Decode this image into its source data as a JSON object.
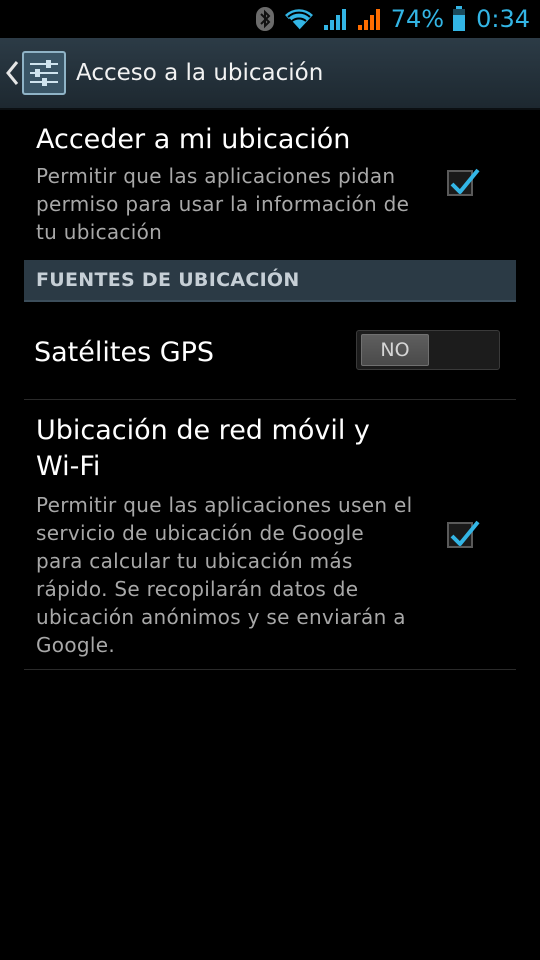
{
  "status_bar": {
    "battery_percent": "74%",
    "time": "0:34",
    "icons": [
      "bluetooth-icon",
      "wifi-icon",
      "signal-icon",
      "signal-roaming-icon",
      "battery-icon"
    ],
    "accent_color": "#33b5e5",
    "signal_orange": "#ff6d00"
  },
  "action_bar": {
    "title": "Acceso a la ubicación",
    "icons": [
      "back-chevron-icon",
      "settings-sliders-icon"
    ]
  },
  "prefs": {
    "access_location": {
      "title": "Acceder a mi ubicación",
      "summary": "Permitir que las aplicaciones pidan permiso para usar la información de tu ubicación",
      "checked": true
    },
    "category": "FUENTES DE UBICACIÓN",
    "gps": {
      "title": "Satélites GPS",
      "switch_label": "NO",
      "on": false
    },
    "network": {
      "title": "Ubicación de red móvil y Wi-Fi",
      "summary": "Permitir que las aplicaciones usen el servicio de ubicación de Google para calcular tu ubicación más rápido. Se recopilarán datos de ubicación anónimos y se enviarán a Google.",
      "checked": true
    }
  }
}
